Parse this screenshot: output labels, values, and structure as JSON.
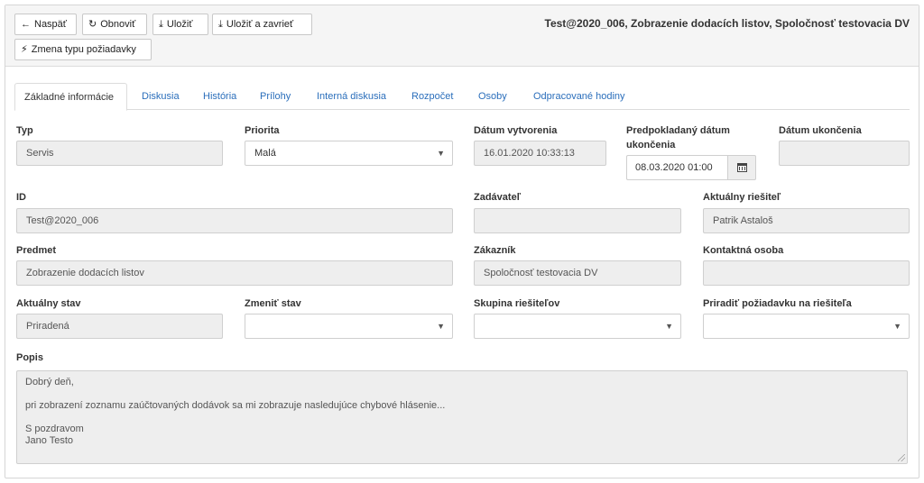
{
  "toolbar": {
    "back_label": "Naspäť",
    "refresh_label": "Obnoviť",
    "save_label": "Uložiť",
    "save_close_label": "Uložiť a zavrieť",
    "change_type_label": "Zmena typu požiadavky",
    "icons": {
      "back": "arrow-left-icon",
      "refresh": "refresh-icon",
      "save": "download-icon",
      "save_close": "download-icon",
      "change_type": "lightning-bolt-icon"
    }
  },
  "page_title": "Test@2020_006, Zobrazenie dodacích listov, Spoločnosť testovacia DV",
  "tabs": [
    {
      "label": "Základné informácie",
      "active": true
    },
    {
      "label": "Diskusia",
      "active": false
    },
    {
      "label": "História",
      "active": false
    },
    {
      "label": "Prílohy",
      "active": false
    },
    {
      "label": "Interná diskusia",
      "active": false
    },
    {
      "label": "Rozpočet",
      "active": false
    },
    {
      "label": "Osoby",
      "active": false
    },
    {
      "label": "Odpracované hodiny",
      "active": false
    }
  ],
  "form": {
    "typ": {
      "label": "Typ",
      "value": "Servis"
    },
    "priorita": {
      "label": "Priorita",
      "value": "Malá"
    },
    "datum_vytvorenia": {
      "label": "Dátum vytvorenia",
      "value": "16.01.2020 10:33:13"
    },
    "predpokladany_datum": {
      "label_line1": "Predpokladaný dátum",
      "label_line2": "ukončenia",
      "value": "08.03.2020 01:00"
    },
    "datum_ukoncenia": {
      "label": "Dátum ukončenia",
      "value": ""
    },
    "id": {
      "label": "ID",
      "value": "Test@2020_006"
    },
    "zadavatel": {
      "label": "Zadávateľ",
      "value": ""
    },
    "aktualny_riesitel": {
      "label": "Aktuálny riešiteľ",
      "value": "Patrik Astaloš"
    },
    "predmet": {
      "label": "Predmet",
      "value": "Zobrazenie dodacích listov"
    },
    "zakaznik": {
      "label": "Zákazník",
      "value": "Spoločnosť testovacia DV"
    },
    "kontaktna_osoba": {
      "label": "Kontaktná osoba",
      "value": ""
    },
    "aktualny_stav": {
      "label": "Aktuálny stav",
      "value": "Priradená"
    },
    "zmenit_stav": {
      "label": "Zmeniť stav",
      "value": ""
    },
    "skupina_riesitelov": {
      "label": "Skupina riešiteľov",
      "value": ""
    },
    "priradit": {
      "label": "Priradiť požiadavku na riešiteľa",
      "value": ""
    },
    "popis": {
      "label": "Popis",
      "lines": [
        "Dobrý deň,",
        "",
        "pri zobrazení zoznamu zaúčtovaných dodávok sa mi zobrazuje nasledujúce chybové hlásenie...",
        "",
        "S pozdravom",
        "Jano Testo"
      ]
    }
  }
}
